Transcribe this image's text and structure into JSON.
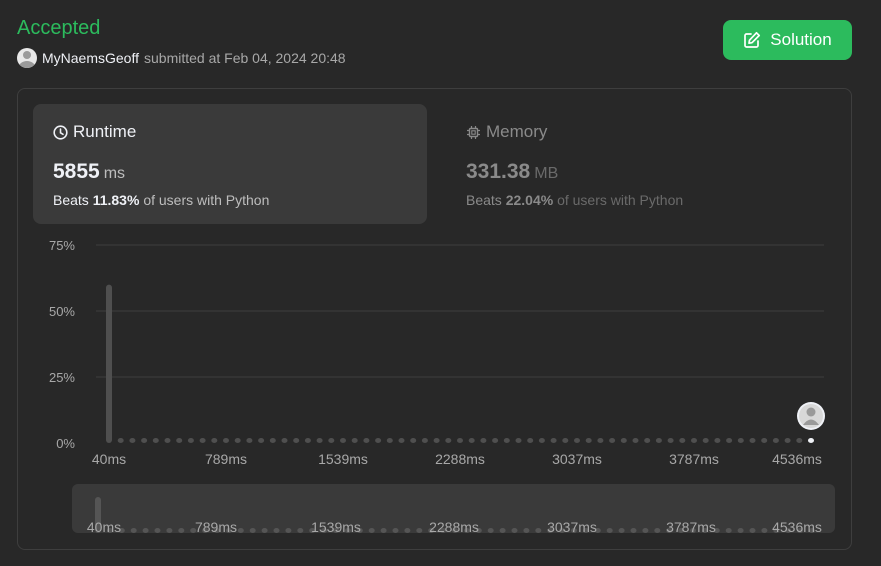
{
  "status": "Accepted",
  "submission": {
    "username": "MyNaemsGeoff",
    "submitted_text": "submitted at Feb 04, 2024 20:48"
  },
  "solution_button": {
    "label": "Solution"
  },
  "runtime": {
    "title": "Runtime",
    "value": "5855",
    "unit": "ms",
    "beats_label": "Beats",
    "beats_value": "11.83%",
    "beats_suffix": "of users with Python"
  },
  "memory": {
    "title": "Memory",
    "value": "331.38",
    "unit": "MB",
    "beats_label": "Beats",
    "beats_value": "22.04%",
    "beats_suffix": "of users with Python"
  },
  "colors": {
    "accent": "#2cbb5d",
    "background": "#282828",
    "card_active": "#3a3a3a",
    "bar": "#4f4f4f",
    "grid": "#3e3e3e"
  },
  "chart_data": {
    "type": "bar",
    "y_ticks": [
      "75%",
      "50%",
      "25%",
      "0%"
    ],
    "ylim": [
      0,
      75
    ],
    "x_tick_labels": [
      "40ms",
      "789ms",
      "1539ms",
      "2288ms",
      "3037ms",
      "3787ms",
      "4536ms"
    ],
    "num_bins": 61,
    "first_bin_value": 60,
    "other_bin_value": 0.5,
    "user_bin_index": 60,
    "grid": true
  }
}
